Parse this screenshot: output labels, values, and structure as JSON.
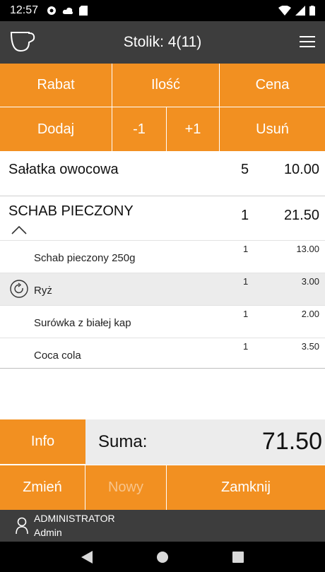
{
  "status": {
    "time": "12:57"
  },
  "appbar": {
    "title": "Stolik: 4(11)"
  },
  "buttons": {
    "rabat": "Rabat",
    "ilosc": "Ilość",
    "cena": "Cena",
    "dodaj": "Dodaj",
    "minus": "-1",
    "plus": "+1",
    "usun": "Usuń"
  },
  "items": [
    {
      "name": "Sałatka owocowa",
      "qty": "5",
      "price": "10.00"
    },
    {
      "name": "SCHAB PIECZONY",
      "qty": "1",
      "price": "21.50"
    }
  ],
  "subitems": [
    {
      "name": "Schab pieczony 250g",
      "qty": "1",
      "price": "13.00"
    },
    {
      "name": "Ryż",
      "qty": "1",
      "price": "3.00"
    },
    {
      "name": "Surówka z białej kap",
      "qty": "1",
      "price": "2.00"
    },
    {
      "name": "Coca cola",
      "qty": "1",
      "price": "3.50"
    }
  ],
  "summary": {
    "info": "Info",
    "label": "Suma:",
    "value": "71.50"
  },
  "actions": {
    "zmien": "Zmień",
    "nowy": "Nowy",
    "zamknij": "Zamknij"
  },
  "user": {
    "name": "ADMINISTRATOR",
    "role": "Admin"
  },
  "colors": {
    "accent": "#f29021",
    "bar": "#3d3d3d",
    "highlight": "#ececec"
  }
}
